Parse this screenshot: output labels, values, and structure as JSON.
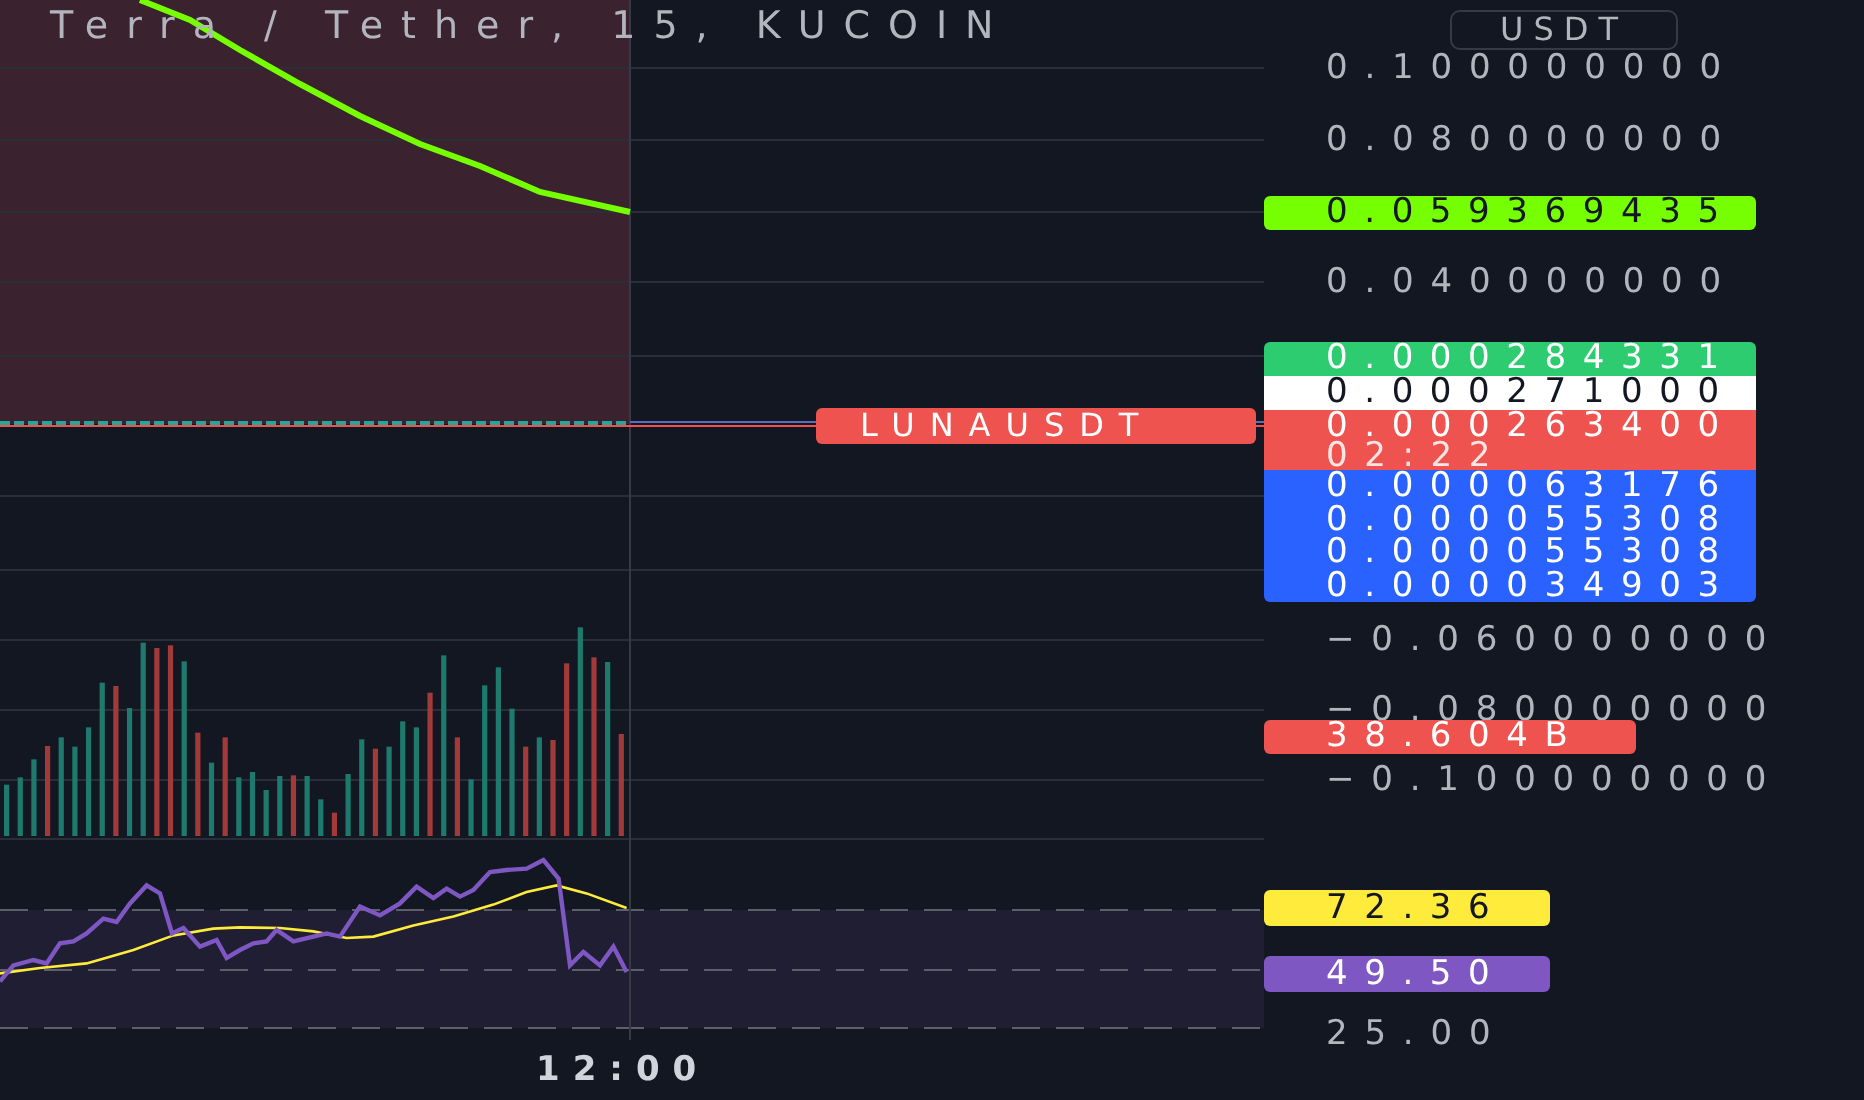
{
  "chart": {
    "title": "Terra / Tether, 15, KUCOIN",
    "symbol_tag": "LUNAUSDT"
  },
  "price_axis": {
    "currency": "USDT",
    "ticks": [
      "0.100000000",
      "0.080000000",
      "0.040000000",
      "−0.060000000",
      "−0.080000000",
      "−0.100000000"
    ],
    "labels": [
      {
        "text": "0.059369435",
        "color": "#76ff03"
      },
      {
        "text": "0.000284331",
        "color": "#2ecc71"
      },
      {
        "text": "0.000271000",
        "color": "#ffffff"
      },
      {
        "text": "0.000263400",
        "color": "#ef5350",
        "countdown": "02:22"
      },
      {
        "text": "0.000063176",
        "color": "#2962ff"
      },
      {
        "text": "0.000055308",
        "color": "#2962ff"
      },
      {
        "text": "0.000055308",
        "color": "#2962ff"
      },
      {
        "text": "0.000034903",
        "color": "#2962ff"
      }
    ]
  },
  "volume": {
    "label": "38.604B",
    "color": "#ef5350"
  },
  "rsi": {
    "labels": [
      {
        "text": "72.36",
        "color": "#ffeb3b"
      },
      {
        "text": "49.50",
        "color": "#7e57c2"
      }
    ],
    "ticks": [
      "25.00"
    ]
  },
  "time_axis": {
    "labels": [
      "12:00"
    ]
  }
}
